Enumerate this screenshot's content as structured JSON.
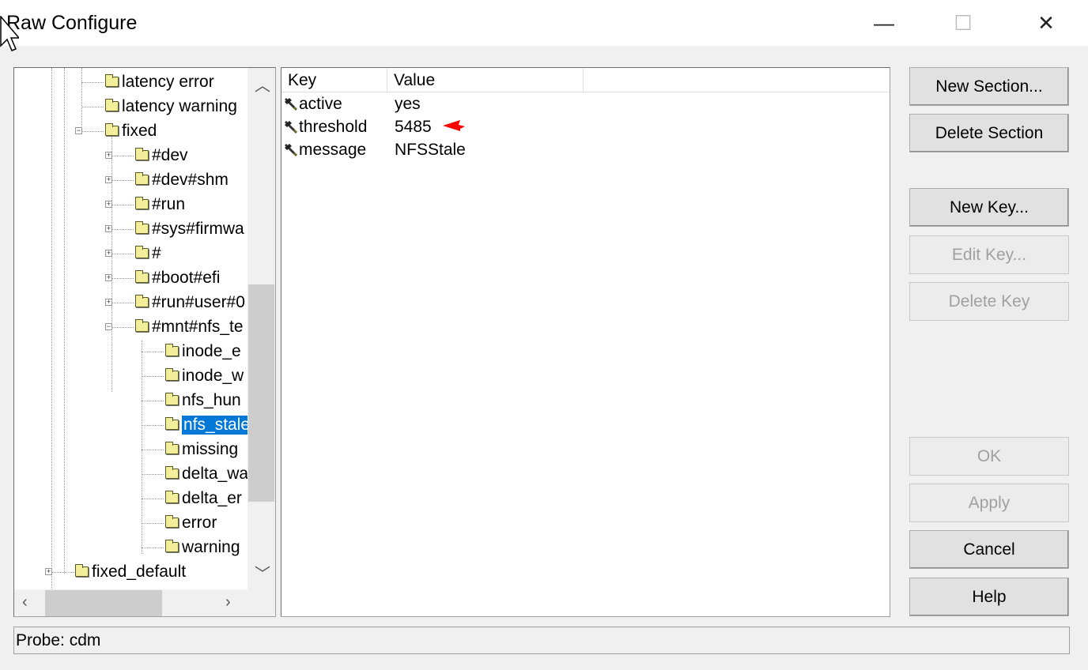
{
  "window": {
    "title": "Raw Configure",
    "minimize": "—",
    "maximize": "☐",
    "close": "✕"
  },
  "tree": {
    "items": [
      {
        "label": "latency error",
        "level": 2,
        "expander": ""
      },
      {
        "label": "latency warning",
        "level": 2,
        "expander": ""
      },
      {
        "label": "fixed",
        "level": 2,
        "expander": "minus"
      },
      {
        "label": "#dev",
        "level": 3,
        "expander": "plus"
      },
      {
        "label": "#dev#shm",
        "level": 3,
        "expander": "plus"
      },
      {
        "label": "#run",
        "level": 3,
        "expander": "plus"
      },
      {
        "label": "#sys#firmwa",
        "level": 3,
        "expander": "plus"
      },
      {
        "label": "#",
        "level": 3,
        "expander": "plus"
      },
      {
        "label": "#boot#efi",
        "level": 3,
        "expander": "plus"
      },
      {
        "label": "#run#user#0",
        "level": 3,
        "expander": "plus"
      },
      {
        "label": "#mnt#nfs_te",
        "level": 3,
        "expander": "minus"
      },
      {
        "label": "inode_e",
        "level": 4,
        "expander": ""
      },
      {
        "label": "inode_w",
        "level": 4,
        "expander": ""
      },
      {
        "label": "nfs_hun",
        "level": 4,
        "expander": ""
      },
      {
        "label": "nfs_stale",
        "level": 4,
        "expander": "",
        "selected": true
      },
      {
        "label": "missing",
        "level": 4,
        "expander": ""
      },
      {
        "label": "delta_wa",
        "level": 4,
        "expander": ""
      },
      {
        "label": "delta_er",
        "level": 4,
        "expander": ""
      },
      {
        "label": "error",
        "level": 4,
        "expander": ""
      },
      {
        "label": "warning",
        "level": 4,
        "expander": ""
      },
      {
        "label": "fixed_default",
        "level": 1,
        "expander": "plus"
      }
    ]
  },
  "list": {
    "columns": [
      "Key",
      "Value"
    ],
    "rows": [
      {
        "key": "active",
        "value": "yes"
      },
      {
        "key": "threshold",
        "value": "5485",
        "annotated": true
      },
      {
        "key": "message",
        "value": "NFSStale"
      }
    ]
  },
  "buttons": {
    "new_section": "New Section...",
    "delete_section": "Delete Section",
    "new_key": "New Key...",
    "edit_key": "Edit Key...",
    "delete_key": "Delete Key",
    "ok": "OK",
    "apply": "Apply",
    "cancel": "Cancel",
    "help": "Help"
  },
  "status": "Probe: cdm",
  "colors": {
    "selection": "#0078d7",
    "annotation_arrow": "#ff0000"
  }
}
